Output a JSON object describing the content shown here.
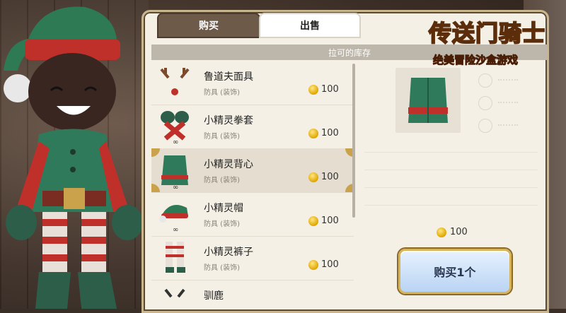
{
  "tabs": {
    "buy": "购买",
    "sell": "出售"
  },
  "inventory_title": "拉可的库存",
  "items": [
    {
      "name": "鲁道夫面具",
      "type": "防具 (装饰)",
      "price": "100",
      "icon": "reindeer-mask-icon"
    },
    {
      "name": "小精灵拳套",
      "type": "防具 (装饰)",
      "price": "100",
      "icon": "elf-gloves-icon"
    },
    {
      "name": "小精灵背心",
      "type": "防具 (装饰)",
      "price": "100",
      "icon": "elf-vest-icon",
      "selected": true
    },
    {
      "name": "小精灵帽",
      "type": "防具 (装饰)",
      "price": "100",
      "icon": "elf-hat-icon"
    },
    {
      "name": "小精灵裤子",
      "type": "防具 (装饰)",
      "price": "100",
      "icon": "elf-pants-icon"
    },
    {
      "name": "驯鹿",
      "type": "",
      "price": "",
      "icon": "reindeer-icon"
    }
  ],
  "detail": {
    "price": "100",
    "buy_label": "购买1个",
    "stat_placeholder": "- - -"
  },
  "logo": {
    "title": "传送门骑士",
    "subtitle": "绝美冒险沙盒游戏"
  },
  "colors": {
    "tab_active": "#6e5a48",
    "coin": "#e0a600",
    "buy_button": "#b9d4f3"
  }
}
